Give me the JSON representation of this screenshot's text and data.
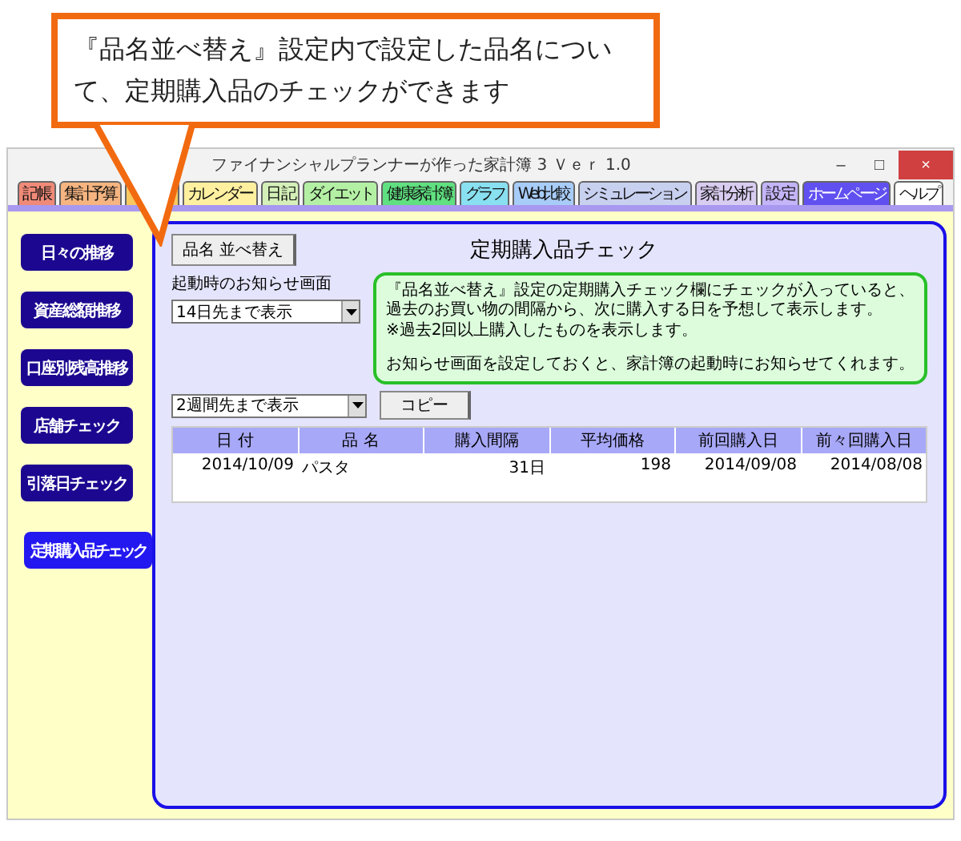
{
  "callout": {
    "lines": [
      "『品名並べ替え』設定内で設定した品名につい",
      "て、定期購入品のチェックができます"
    ]
  },
  "window": {
    "title": "ファイナンシャルプランナーが作った家計簿 3 Ｖｅｒ 1.0",
    "controls": [
      "–",
      "□",
      "×"
    ]
  },
  "tabs": [
    {
      "label": "記 帳",
      "color": "#f08a78"
    },
    {
      "label": "集計予算",
      "color": "#f5b480"
    },
    {
      "color": "#f8c860"
    },
    {
      "label": "カレンダー",
      "color": "#fff0a0"
    },
    {
      "label": "日 記",
      "color": "#d4f0b8"
    },
    {
      "label": "ダイエット",
      "color": "#b4f0a4"
    },
    {
      "label": "健康家計簿",
      "color": "#60e080"
    },
    {
      "label": "グラフ",
      "color": "#88e0f0"
    },
    {
      "label": "Web比較",
      "color": "#a8ccf8"
    },
    {
      "label": "シミュレーション",
      "color": "#c8d0f0"
    },
    {
      "label": "家計分析",
      "color": "#d8ccf0"
    },
    {
      "label": "設 定",
      "color": "#c4b4f8"
    },
    {
      "label": "ホームページ",
      "color": "#6050f0"
    },
    {
      "label": "ヘルプ",
      "color": "#ffffff"
    }
  ],
  "sidebar": {
    "items": [
      {
        "label": "日々の推移",
        "selected": false
      },
      {
        "label": "資産総額推移",
        "selected": false
      },
      {
        "label": "口座別残高推移",
        "selected": false
      },
      {
        "label": "店舗チェック",
        "selected": false
      },
      {
        "label": "引落日チェック",
        "selected": false
      },
      {
        "label": "定期購入品チェック",
        "selected": true
      }
    ]
  },
  "main": {
    "sort_button": "品名 並べ替え",
    "title": "定期購入品チェック",
    "startup_label": "起動時のお知らせ画面",
    "startup_select": "14日先まで表示",
    "range_select": "2週間先まで表示",
    "copy_button": "コピー",
    "info": [
      "『品名並べ替え』設定の定期購入チェック欄にチェックが入っていると、過去のお買い物の間隔から、次に購入する日を予想して表示します。",
      "※過去2回以上購入したものを表示します。",
      "お知らせ画面を設定しておくと、家計簿の起動時にお知らせてくれます。"
    ]
  },
  "table": {
    "columns": [
      "日 付",
      "品 名",
      "購入間隔",
      "平均価格",
      "前回購入日",
      "前々回購入日"
    ],
    "rows": [
      [
        "2014/10/09",
        "パスタ",
        "31日",
        "198",
        "2014/09/08",
        "2014/08/08"
      ]
    ]
  }
}
